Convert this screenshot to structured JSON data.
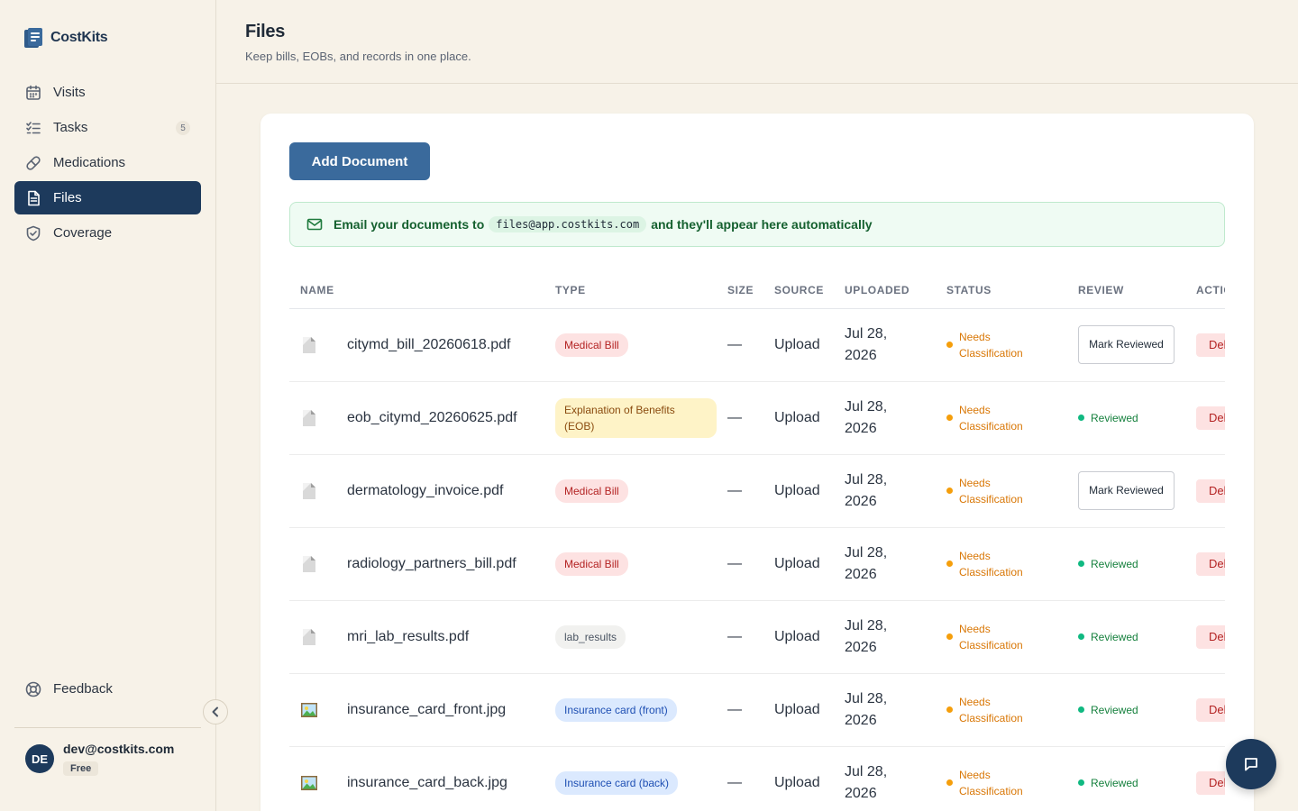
{
  "brand": {
    "name": "CostKits"
  },
  "sidebar": {
    "items": [
      {
        "label": "Visits",
        "icon": "calendar-icon"
      },
      {
        "label": "Tasks",
        "icon": "checklist-icon",
        "badge": "5"
      },
      {
        "label": "Medications",
        "icon": "pill-icon"
      },
      {
        "label": "Files",
        "icon": "document-icon",
        "active": true
      },
      {
        "label": "Coverage",
        "icon": "shield-icon"
      }
    ],
    "feedback_label": "Feedback",
    "user": {
      "initials": "DE",
      "email": "dev@costkits.com",
      "plan": "Free"
    }
  },
  "header": {
    "title": "Files",
    "subtitle": "Keep bills, EOBs, and records in one place."
  },
  "main": {
    "add_button": "Add Document",
    "email_banner": {
      "prefix": "Email your documents to",
      "address": "files@app.costkits.com",
      "suffix": "and they'll appear here automatically"
    },
    "table": {
      "columns": [
        "NAME",
        "TYPE",
        "SIZE",
        "SOURCE",
        "UPLOADED",
        "STATUS",
        "REVIEW",
        "ACTIONS"
      ],
      "mark_reviewed_label": "Mark Reviewed",
      "reviewed_label": "Reviewed",
      "delete_label": "Delete",
      "rows": [
        {
          "name": "citymd_bill_20260618.pdf",
          "kind": "pdf",
          "type": "Medical Bill",
          "type_style": "bill",
          "size": "—",
          "source": "Upload",
          "uploaded": "Jul 28, 2026",
          "status": "Needs Classification",
          "reviewed": false
        },
        {
          "name": "eob_citymd_20260625.pdf",
          "kind": "pdf",
          "type": "Explanation of Benefits (EOB)",
          "type_style": "eob",
          "size": "—",
          "source": "Upload",
          "uploaded": "Jul 28, 2026",
          "status": "Needs Classification",
          "reviewed": true
        },
        {
          "name": "dermatology_invoice.pdf",
          "kind": "pdf",
          "type": "Medical Bill",
          "type_style": "bill",
          "size": "—",
          "source": "Upload",
          "uploaded": "Jul 28, 2026",
          "status": "Needs Classification",
          "reviewed": false
        },
        {
          "name": "radiology_partners_bill.pdf",
          "kind": "pdf",
          "type": "Medical Bill",
          "type_style": "bill",
          "size": "—",
          "source": "Upload",
          "uploaded": "Jul 28, 2026",
          "status": "Needs Classification",
          "reviewed": true
        },
        {
          "name": "mri_lab_results.pdf",
          "kind": "pdf",
          "type": "lab_results",
          "type_style": "lab",
          "size": "—",
          "source": "Upload",
          "uploaded": "Jul 28, 2026",
          "status": "Needs Classification",
          "reviewed": true
        },
        {
          "name": "insurance_card_front.jpg",
          "kind": "image",
          "type": "Insurance card (front)",
          "type_style": "ins",
          "size": "—",
          "source": "Upload",
          "uploaded": "Jul 28, 2026",
          "status": "Needs Classification",
          "reviewed": true
        },
        {
          "name": "insurance_card_back.jpg",
          "kind": "image",
          "type": "Insurance card (back)",
          "type_style": "ins",
          "size": "—",
          "source": "Upload",
          "uploaded": "Jul 28, 2026",
          "status": "Needs Classification",
          "reviewed": true
        }
      ]
    }
  },
  "colors": {
    "accent": "#1d3a5c",
    "button": "#3a6a9c",
    "background": "#f7f2e8",
    "warning": "#d97706",
    "success": "#15803d",
    "danger": "#b42323"
  }
}
